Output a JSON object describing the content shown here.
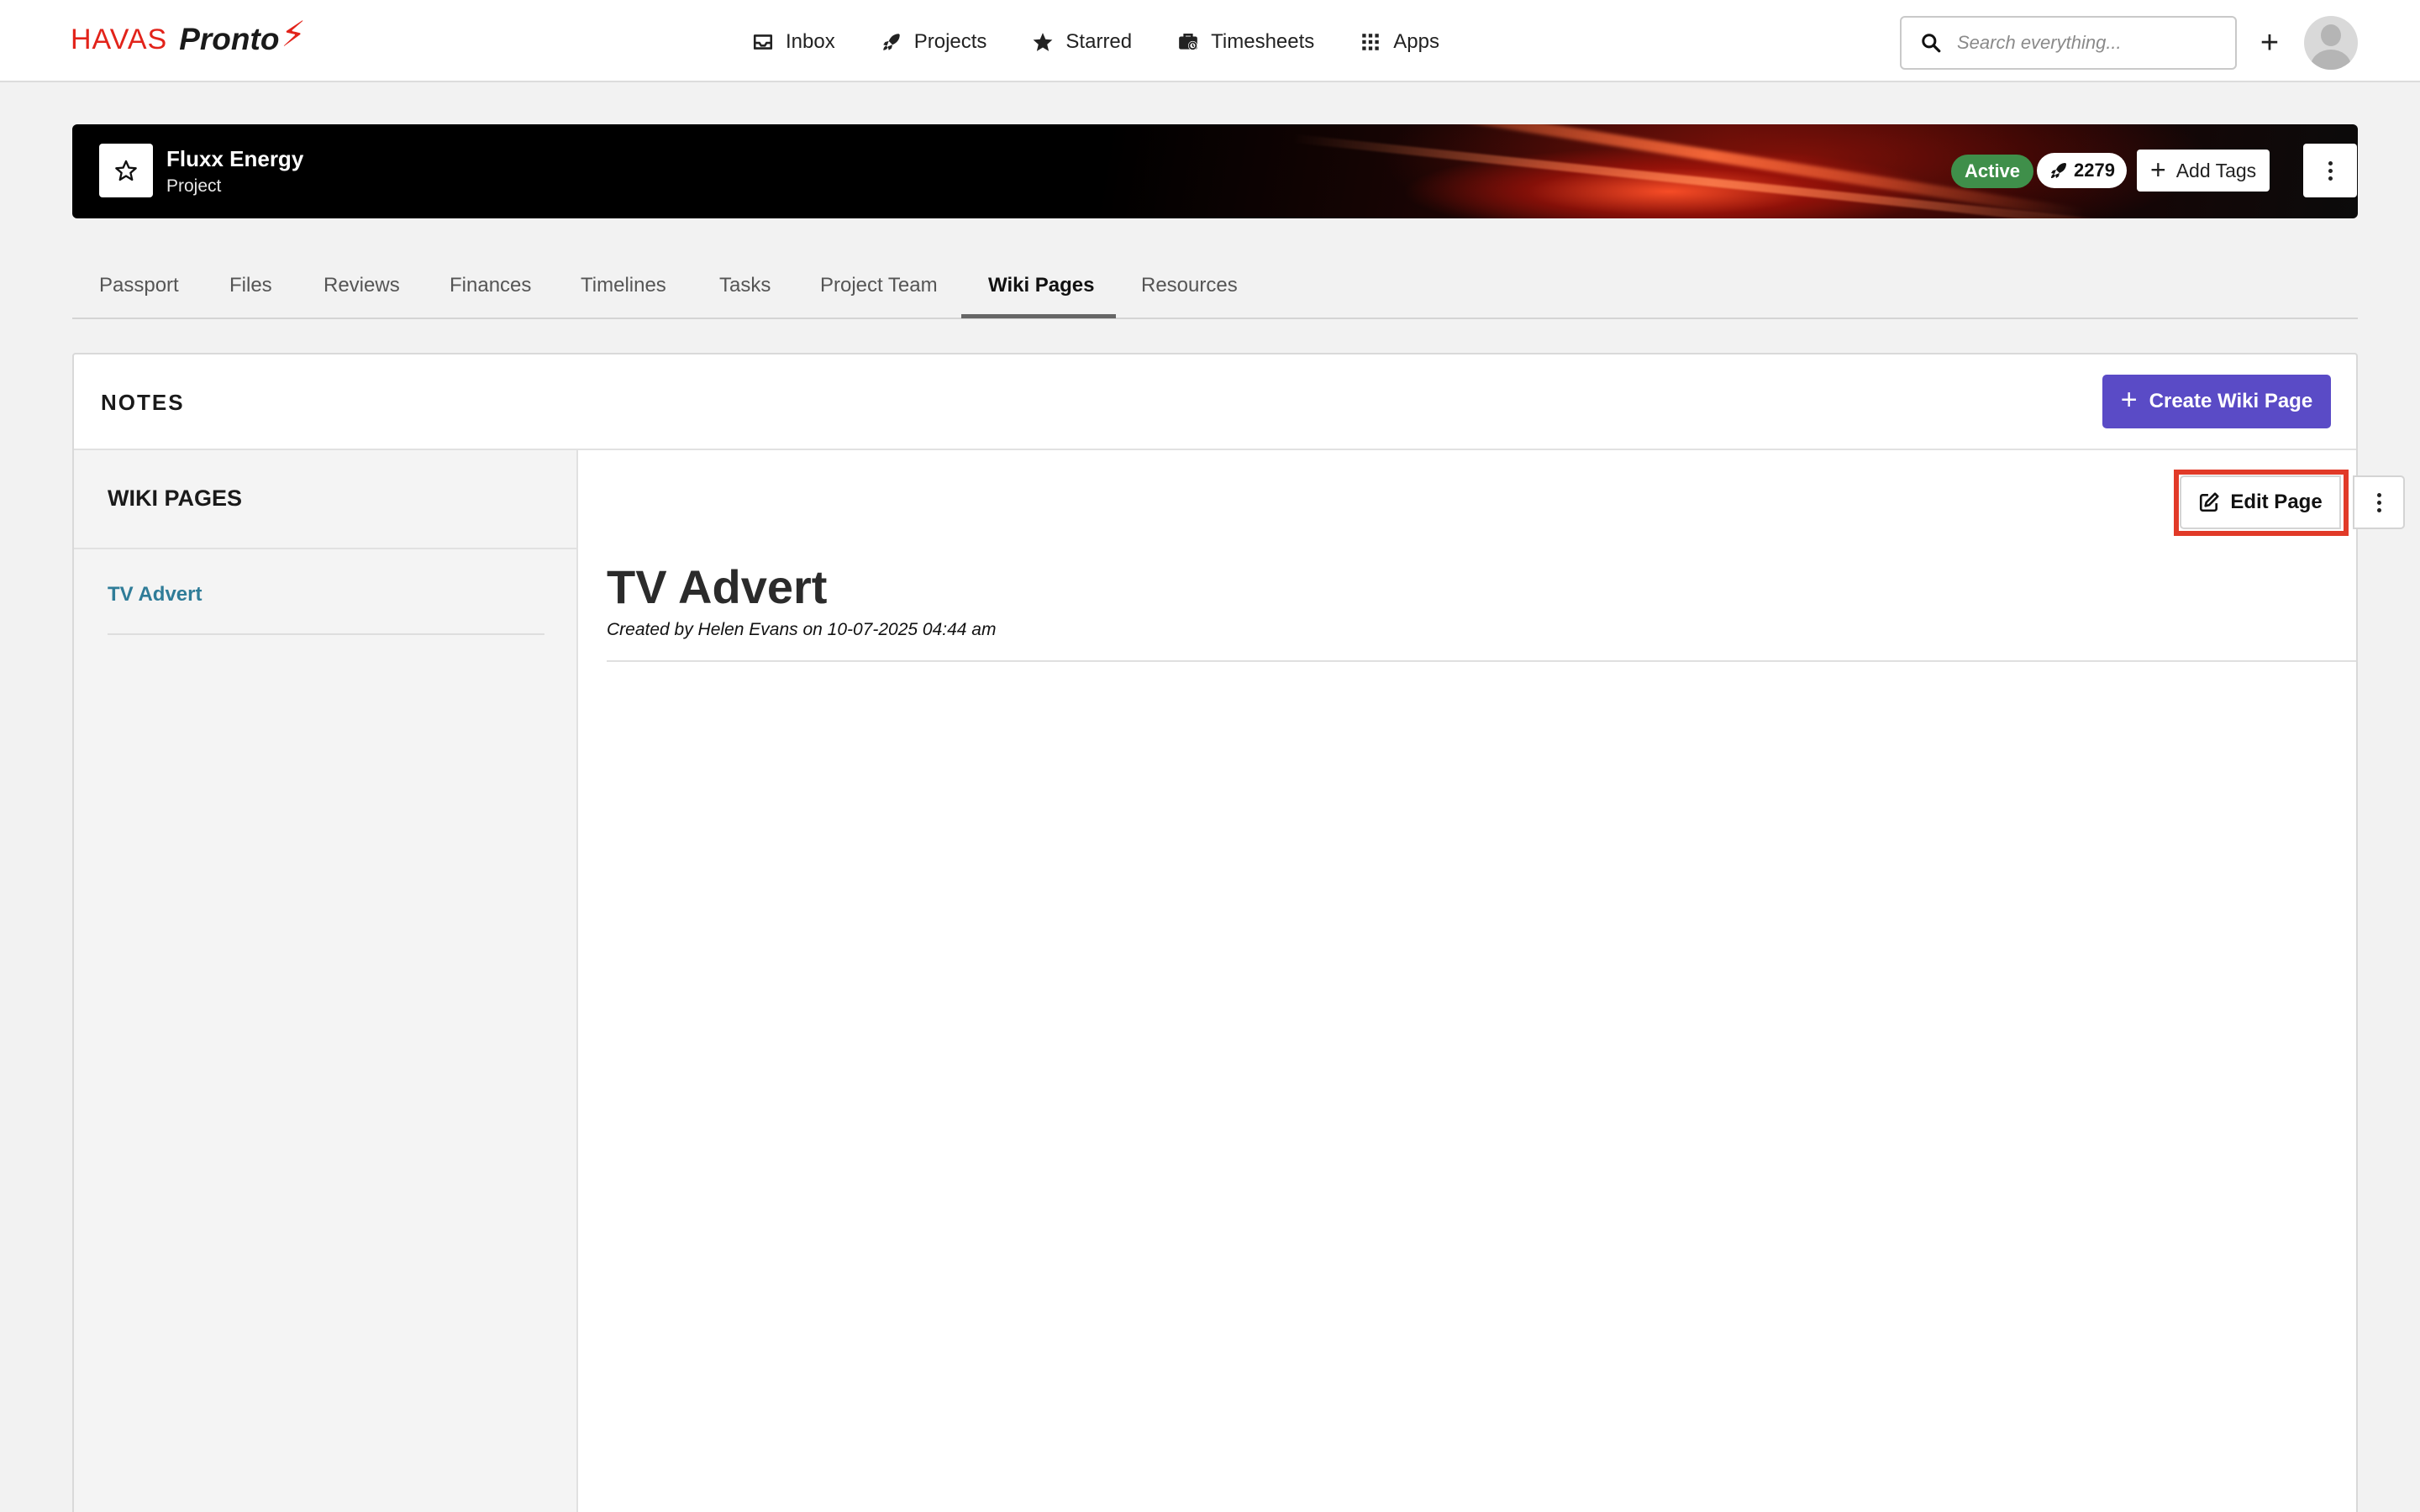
{
  "brand": {
    "havas": "HAVAS",
    "pronto": "Pronto",
    "bolt": "⚡"
  },
  "nav": {
    "items": [
      {
        "label": "Inbox",
        "icon": "inbox-icon"
      },
      {
        "label": "Projects",
        "icon": "rocket-icon"
      },
      {
        "label": "Starred",
        "icon": "star-icon"
      },
      {
        "label": "Timesheets",
        "icon": "timesheet-icon"
      },
      {
        "label": "Apps",
        "icon": "grid-icon"
      }
    ],
    "search_placeholder": "Search everything...",
    "add_label": "+"
  },
  "project": {
    "title": "Fluxx Energy",
    "subtitle": "Project",
    "status": "Active",
    "count": "2279",
    "add_tags_label": "Add Tags"
  },
  "tabs": [
    {
      "label": "Passport",
      "active": false
    },
    {
      "label": "Files",
      "active": false
    },
    {
      "label": "Reviews",
      "active": false
    },
    {
      "label": "Finances",
      "active": false
    },
    {
      "label": "Timelines",
      "active": false
    },
    {
      "label": "Tasks",
      "active": false
    },
    {
      "label": "Project Team",
      "active": false
    },
    {
      "label": "Wiki Pages",
      "active": true
    },
    {
      "label": "Resources",
      "active": false
    }
  ],
  "notes": {
    "title": "NOTES",
    "create_label": "Create Wiki Page",
    "sidebar_title": "WIKI PAGES",
    "pages": [
      {
        "label": "TV Advert"
      }
    ]
  },
  "page": {
    "title": "TV Advert",
    "meta": "Created by Helen Evans on 10-07-2025 04:44 am",
    "edit_label": "Edit Page"
  },
  "colors": {
    "accent": "#5a4bc6",
    "status_green": "#3f8f4a",
    "link": "#2f7c98",
    "highlight": "#e13a28",
    "brand_red": "#e2231a"
  }
}
